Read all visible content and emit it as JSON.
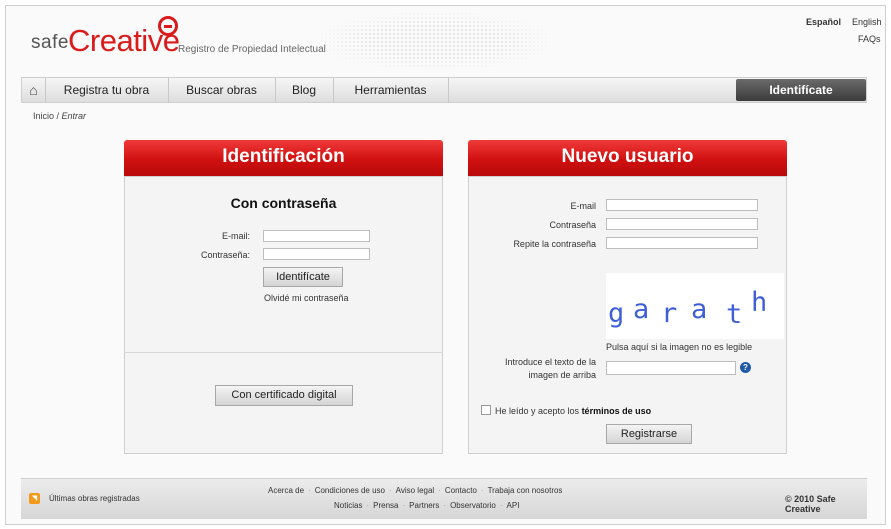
{
  "header": {
    "logo_text_1": "safe",
    "logo_text_2": "Creative",
    "tagline": "Registro de Propiedad Intelectual",
    "lang_es": "Español",
    "lang_en": "English",
    "faqs": "FAQs"
  },
  "nav": {
    "home_icon": "home-icon",
    "items": [
      "Registra tu obra",
      "Buscar obras",
      "Blog",
      "Herramientas"
    ],
    "login": "Identifícate"
  },
  "breadcrumb": {
    "home": "Inicio",
    "sep": " / ",
    "current": "Entrar"
  },
  "login_panel": {
    "title": "Identificación",
    "subtitle": "Con contraseña",
    "email_label": "E-mail:",
    "password_label": "Contraseña:",
    "submit": "Identifícate",
    "forgot": "Olvidé mi contraseña",
    "cert_button": "Con certificado digital"
  },
  "register_panel": {
    "title": "Nuevo usuario",
    "email_label": "E-mail",
    "password_label": "Contraseña",
    "repeat_label": "Repite la contraseña",
    "captcha_text": "garath",
    "captcha_hint": "Pulsa aquí si la imagen no es legible",
    "captcha_label_1": "Introduce el texto de la",
    "captcha_label_2": "imagen de arriba",
    "terms_prefix": "He leído y acepto los ",
    "terms_link": "términos de uso",
    "submit": "Registrarse"
  },
  "footer": {
    "rss_label": "Últimas obras registradas",
    "links_row1": [
      "Acerca de",
      "Condiciones de uso",
      "Aviso legal",
      "Contacto",
      "Trabaja con nosotros"
    ],
    "links_row2": [
      "Noticias",
      "Prensa",
      "Partners",
      "Observatorio",
      "API"
    ],
    "copyright": "© 2010 Safe Creative"
  },
  "colors": {
    "brand_red": "#d91b1b",
    "nav_dark": "#3b3b3b",
    "captcha_blue": "#3f5fd8"
  }
}
